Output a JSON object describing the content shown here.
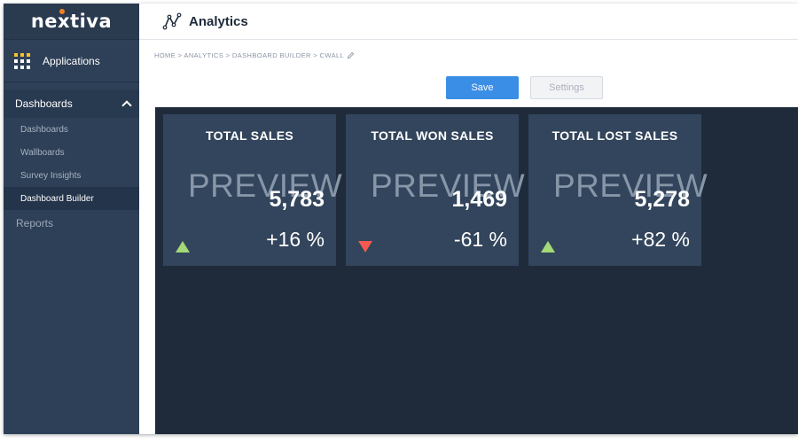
{
  "brand": {
    "logo_text_pre": "ne",
    "logo_text_x": "x",
    "logo_text_post": "tiva"
  },
  "sidebar": {
    "applications_label": "Applications",
    "dashboards_label": "Dashboards",
    "items": [
      {
        "label": "Dashboards",
        "active": false
      },
      {
        "label": "Wallboards",
        "active": false
      },
      {
        "label": "Survey Insights",
        "active": false
      },
      {
        "label": "Dashboard Builder",
        "active": true
      }
    ],
    "reports_label": "Reports"
  },
  "header": {
    "title": "Analytics",
    "icon": "analytics-icon"
  },
  "breadcrumb": {
    "text": "HOME > ANALYTICS > DASHBOARD BUILDER > CWALL",
    "icon": "pencil-icon"
  },
  "toolbar": {
    "save_label": "Save",
    "settings_label": "Settings"
  },
  "cards": [
    {
      "title": "TOTAL SALES",
      "preview": "PREVIEW",
      "value": "5,783",
      "change": "+16 %",
      "trend": "up"
    },
    {
      "title": "TOTAL WON SALES",
      "preview": "PREVIEW",
      "value": "1,469",
      "change": "-61 %",
      "trend": "down"
    },
    {
      "title": "TOTAL LOST SALES",
      "preview": "PREVIEW",
      "value": "5,278",
      "change": "+82 %",
      "trend": "up"
    }
  ],
  "colors": {
    "sidebar_bg": "#2e4057",
    "canvas_bg": "#1f2b3b",
    "card_bg": "#33455c",
    "save_button": "#3b8ee6",
    "trend_up": "#a3d977",
    "trend_down": "#f05a50",
    "brand_accent": "#f58220"
  }
}
